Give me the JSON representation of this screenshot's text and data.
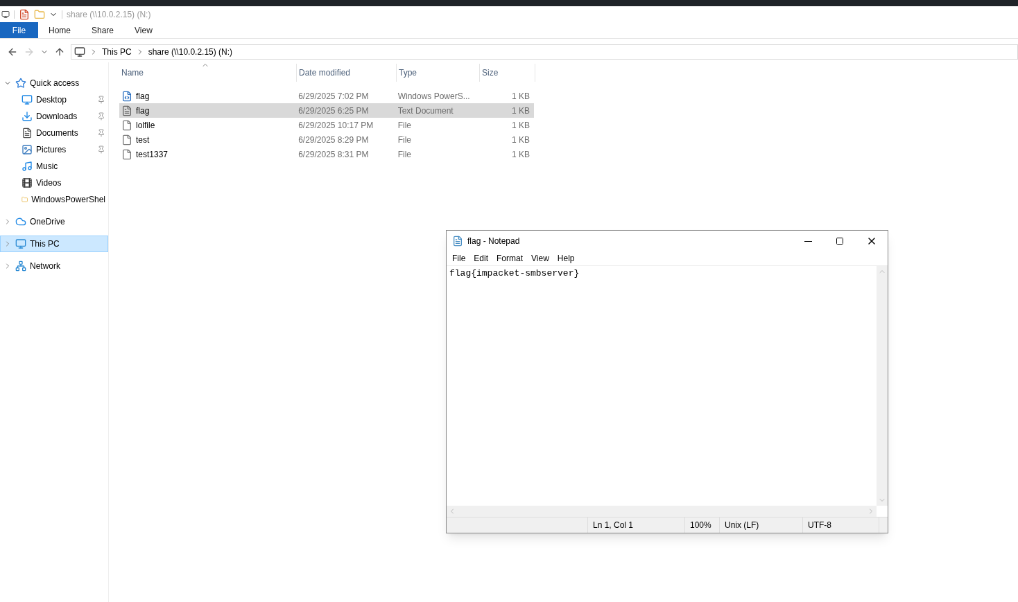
{
  "explorer": {
    "title": "share (\\\\10.0.2.15) (N:)",
    "ribbon_tabs": [
      {
        "label": "File",
        "selected": true
      },
      {
        "label": "Home",
        "selected": false
      },
      {
        "label": "Share",
        "selected": false
      },
      {
        "label": "View",
        "selected": false
      }
    ],
    "breadcrumb": [
      "This PC",
      "share (\\\\10.0.2.15) (N:)"
    ],
    "sidebar": [
      {
        "label": "Quick access",
        "expanded": true,
        "selected": false,
        "children": [
          {
            "label": "Desktop",
            "pinned": true
          },
          {
            "label": "Downloads",
            "pinned": true
          },
          {
            "label": "Documents",
            "pinned": true
          },
          {
            "label": "Pictures",
            "pinned": true
          },
          {
            "label": "Music",
            "pinned": false
          },
          {
            "label": "Videos",
            "pinned": false
          },
          {
            "label": "WindowsPowerShel",
            "pinned": false
          }
        ]
      },
      {
        "label": "OneDrive",
        "expanded": false,
        "selected": false
      },
      {
        "label": "This PC",
        "expanded": false,
        "selected": true
      },
      {
        "label": "Network",
        "expanded": false,
        "selected": false
      }
    ],
    "table": {
      "columns": [
        "Name",
        "Date modified",
        "Type",
        "Size"
      ],
      "rows": [
        {
          "name": "flag",
          "date": "6/29/2025 7:02 PM",
          "type": "Windows PowerS...",
          "size": "1 KB",
          "selected": false
        },
        {
          "name": "flag",
          "date": "6/29/2025 6:25 PM",
          "type": "Text Document",
          "size": "1 KB",
          "selected": true
        },
        {
          "name": "lolfile",
          "date": "6/29/2025 10:17 PM",
          "type": "File",
          "size": "1 KB",
          "selected": false
        },
        {
          "name": "test",
          "date": "6/29/2025 8:29 PM",
          "type": "File",
          "size": "1 KB",
          "selected": false
        },
        {
          "name": "test1337",
          "date": "6/29/2025 8:31 PM",
          "type": "File",
          "size": "1 KB",
          "selected": false
        }
      ]
    }
  },
  "notepad": {
    "title": "flag - Notepad",
    "menu": [
      "File",
      "Edit",
      "Format",
      "View",
      "Help"
    ],
    "content": "flag{impacket-smbserver}",
    "status_bar": [
      "Ln 1, Col 1",
      "100%",
      "Unix (LF)",
      "UTF-8"
    ]
  }
}
